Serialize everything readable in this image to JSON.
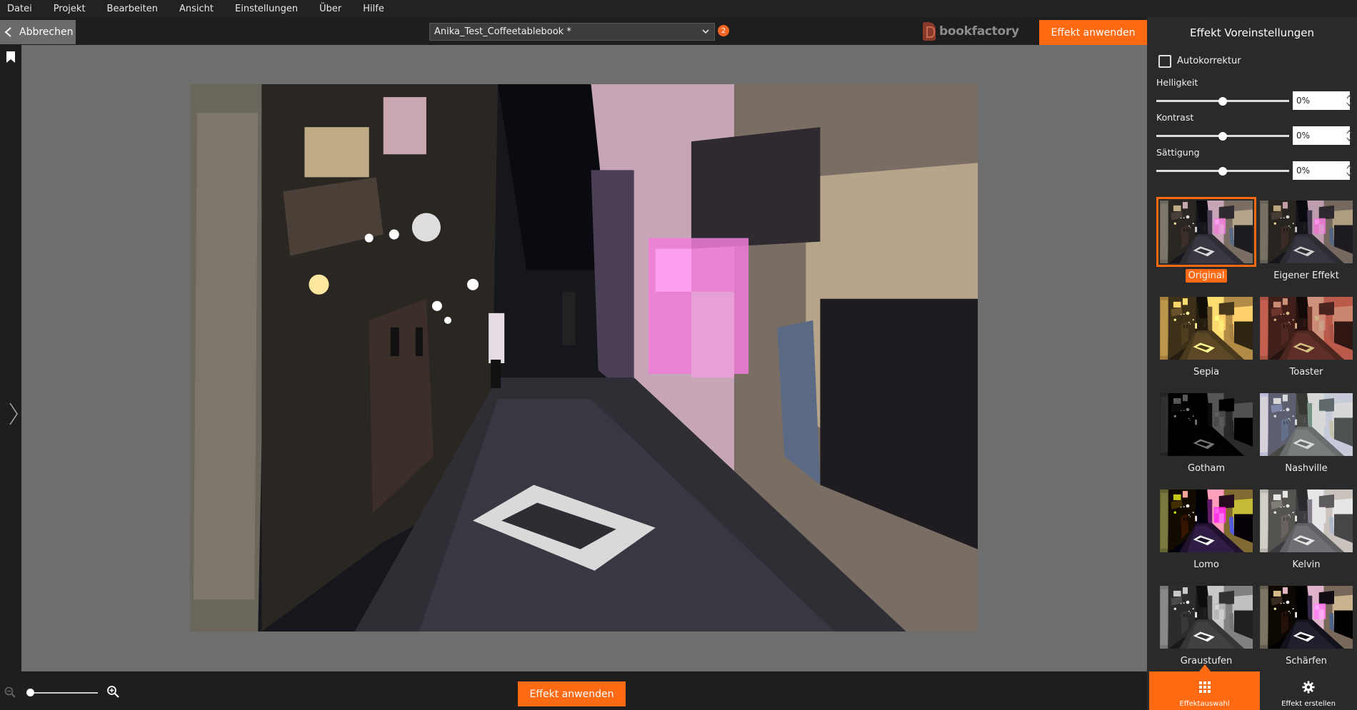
{
  "menu": [
    "Datei",
    "Projekt",
    "Bearbeiten",
    "Ansicht",
    "Einstellungen",
    "Über",
    "Hilfe"
  ],
  "toolbar": {
    "cancel_label": "Abbrechen",
    "project_name": "Anika_Test_Coffeetablebook *",
    "notification_count": "2",
    "brand": "bookfactory",
    "apply_label": "Effekt anwenden"
  },
  "bottom": {
    "apply_label": "Effekt anwenden",
    "zoom_level": 0
  },
  "panel": {
    "title": "Effekt Voreinstellungen",
    "autocorrect_label": "Autokorrektur",
    "autocorrect_checked": false,
    "sliders": [
      {
        "label": "Helligkeit",
        "value": "0%",
        "position": 0.5
      },
      {
        "label": "Kontrast",
        "value": "0%",
        "position": 0.5
      },
      {
        "label": "Sättigung",
        "value": "0%",
        "position": 0.5
      }
    ],
    "effects": [
      {
        "label": "Original",
        "selected": true
      },
      {
        "label": "Eigener Effekt",
        "selected": false
      },
      {
        "label": "Sepia",
        "selected": false
      },
      {
        "label": "Toaster",
        "selected": false
      },
      {
        "label": "Gotham",
        "selected": false
      },
      {
        "label": "Nashville",
        "selected": false
      },
      {
        "label": "Lomo",
        "selected": false
      },
      {
        "label": "Kelvin",
        "selected": false
      },
      {
        "label": "Graustufen",
        "selected": false
      },
      {
        "label": "Schärfen",
        "selected": false
      }
    ],
    "tabs": [
      {
        "label": "Effektauswahl",
        "active": true
      },
      {
        "label": "Effekt erstellen",
        "active": false
      }
    ]
  },
  "colors": {
    "accent": "#ff6a13",
    "canvas": "#6e6e6e",
    "chrome": "#1e1e1e",
    "panel": "#2a2a2a"
  }
}
